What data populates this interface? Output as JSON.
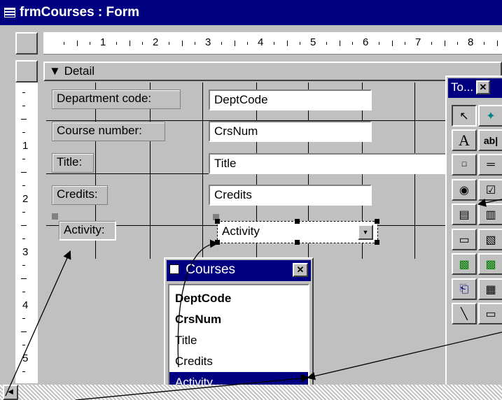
{
  "window": {
    "title": "frmCourses : Form"
  },
  "ruler": {
    "h_marks": [
      "1",
      "2",
      "3",
      "4",
      "5",
      "6",
      "7",
      "8"
    ],
    "v_marks": [
      "1",
      "2",
      "3",
      "4",
      "5"
    ]
  },
  "section": {
    "label": "Detail"
  },
  "labels": [
    "Department code:",
    "Course number:",
    "Title:",
    "Credits:",
    "Activity:"
  ],
  "fields": [
    "DeptCode",
    "CrsNum",
    "Title",
    "Credits",
    "Activity"
  ],
  "field_list": {
    "title": "Courses",
    "items": [
      "DeptCode",
      "CrsNum",
      "Title",
      "Credits",
      "Activity"
    ],
    "bold": [
      "DeptCode",
      "CrsNum"
    ],
    "selected": "Activity"
  },
  "toolbox": {
    "title": "To...",
    "close": "✕"
  },
  "colors": {
    "title_bar": "#000080",
    "face": "#c0c0c0",
    "selection": "#000080"
  }
}
